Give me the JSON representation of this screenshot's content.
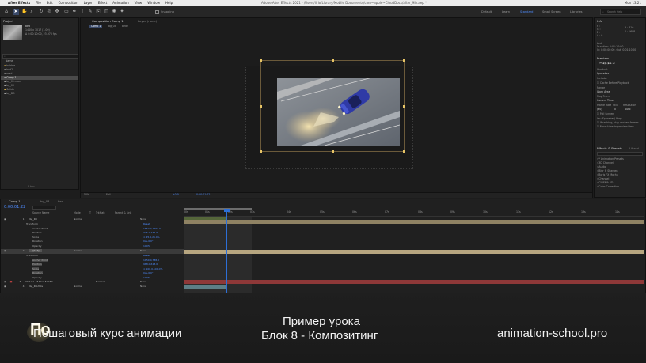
{
  "menubar": {
    "apple": "",
    "app_name": "After Effects",
    "menus": [
      "File",
      "Edit",
      "Composition",
      "Layer",
      "Effect",
      "Animation",
      "View",
      "Window",
      "Help"
    ],
    "window_title": "Adobe After Effects 2021 - /Users/lirio/Library/Mobile Documents/com~apple~CloudDocs/after_9ib.aep *",
    "right_status": "Mon 13:21"
  },
  "toolbar": {
    "snapping_label": "Snapping",
    "workspaces": [
      "Default",
      "Learn",
      "Standard",
      "Small Screen",
      "Libraries"
    ],
    "active_workspace": "Standard",
    "search_placeholder": "Search Help"
  },
  "project": {
    "tab_label": "Project",
    "preview_name": "bed",
    "preview_info": [
      "1440 x 1017 (1.00)",
      "Δ 0:00:10:00, 23.976 fps"
    ],
    "search_placeholder": "",
    "column_name": "Name",
    "items": [
      "bubble",
      "bed2",
      "road",
      "Comp 1",
      "bg_01.mov",
      "bg_00",
      "Solids",
      "bg_BG"
    ]
  },
  "comp_panel": {
    "tabs": [
      "Composition Comp 1",
      "Layer (none)"
    ],
    "nav": [
      "Comp 1",
      "bg_04",
      "bed2"
    ],
    "zoom": "50%",
    "resolution": "Full",
    "timecode": "0:00:01:22",
    "exposure": "+0.0"
  },
  "right_panels": {
    "info_title": "Info",
    "info_values": [
      "R :",
      "G :",
      "B :",
      "A : 0"
    ],
    "info_coords": [
      "X : 416",
      "Y : 1608"
    ],
    "info_meta": [
      "bed",
      "Duration: 0:01:10:00",
      "In: 0:00:00:00, Out: 0:01:10:00"
    ],
    "preview_title": "Preview",
    "shortcut_label": "Shortcut",
    "shortcut_value": "Spacebar",
    "include_label": "Include:",
    "cache_label": "Cache Before Playback",
    "range_label": "Range",
    "range_value": "Work Area",
    "play_from_label": "Play From",
    "play_from_value": "Current Time",
    "frame_rate_label": "Frame Rate",
    "skip_label": "Skip",
    "resolution_label": "Resolution",
    "frame_rate_value": "(30)",
    "skip_value": "0",
    "resolution_value": "Auto",
    "full_screen_label": "Full Screen",
    "on_stop_label": "On (Spacebar) Stop:",
    "if_caching_label": "If caching, play cached frames",
    "move_time_label": "Move time to preview time",
    "effects_title": "Effects & Presets",
    "libraries_title": "Librari",
    "effects_search_placeholder": "",
    "effects_list": [
      "* Animation Presets",
      "3D Channel",
      "Audio",
      "Blur & Sharpen",
      "Boris FX Mocha",
      "Channel",
      "CINEMA 4D",
      "Color Correction"
    ]
  },
  "timeline": {
    "tabs": [
      "Comp 1",
      "bg_04",
      "bed"
    ],
    "timecode": "0:00:01:22",
    "col_headers": [
      "Source Name",
      "Mode",
      "T",
      "TrkMat",
      "Parent & Link"
    ],
    "layers": [
      {
        "num": "1",
        "name": "bg_03",
        "mode": "Normal",
        "parent": "None",
        "props": [
          {
            "name": "Transform",
            "value": "Reset"
          },
          {
            "name": "Anchor Point",
            "value": "1652.0,1263.0"
          },
          {
            "name": "Position",
            "value": "375.0,272.6"
          },
          {
            "name": "Scale",
            "value": "∞ 25.0,25.0%"
          },
          {
            "name": "Rotation",
            "value": "0x+0.0°"
          },
          {
            "name": "Opacity",
            "value": "100%"
          }
        ]
      },
      {
        "num": "2",
        "name": "[bed]",
        "mode": "Normal",
        "parent": "None",
        "props": [
          {
            "name": "Transform",
            "value": "Reset"
          },
          {
            "name": "Anchor Point",
            "value": "1150.0,788.0"
          },
          {
            "name": "Position",
            "value": "968.0,613.0"
          },
          {
            "name": "Scale",
            "value": "∞ 100.0,100.0%"
          },
          {
            "name": "Rotation",
            "value": "0x+0.0°"
          },
          {
            "name": "Opacity",
            "value": "100%"
          }
        ]
      },
      {
        "num": "3",
        "name": "Dark Gr...id Blue Solid 1",
        "mode": "Normal",
        "parent": "None",
        "props": []
      },
      {
        "num": "4",
        "name": "bg_08.mov",
        "mode": "Normal",
        "parent": "None",
        "props": []
      }
    ],
    "ruler": [
      "00s",
      "01s",
      "02s",
      "03s",
      "04s",
      "05s",
      "06s",
      "07s",
      "08s",
      "09s",
      "10s",
      "11s",
      "12s",
      "13s",
      "14s"
    ]
  },
  "overlay": {
    "logo_letters": "По",
    "left_text": "Пошаговый курс анимации",
    "center_line1": "Пример урока",
    "center_line2": "Блок 8 - Композитинг",
    "right_text": "animation-school.pro"
  },
  "colors": {
    "accent_blue": "#4e8cff",
    "playhead": "#2d6fd6",
    "tan_bar": "#8f8263",
    "red_bar": "#8e3838",
    "teal_bar": "#5d7e86",
    "green_bar": "#55663a"
  }
}
